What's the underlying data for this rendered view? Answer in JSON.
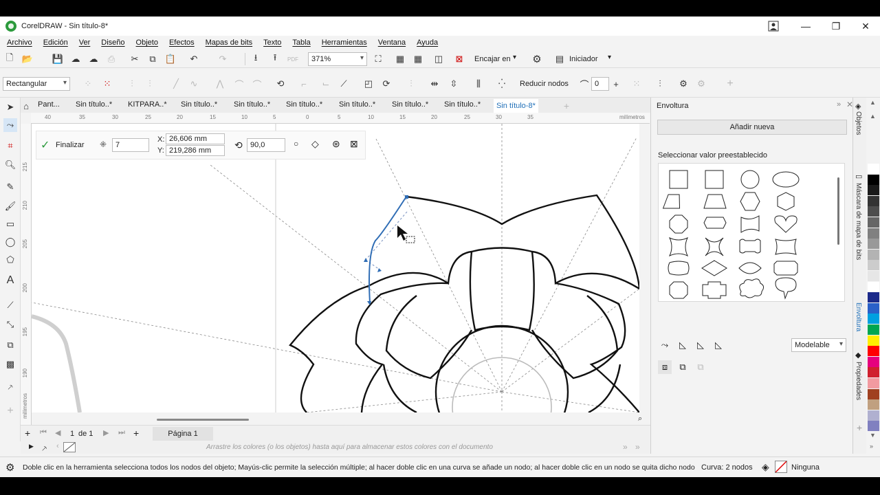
{
  "app": {
    "title": "CorelDRAW - Sin título-8*"
  },
  "menu": [
    "Archivo",
    "Edición",
    "Ver",
    "Diseño",
    "Objeto",
    "Efectos",
    "Mapas de bits",
    "Texto",
    "Tabla",
    "Herramientas",
    "Ventana",
    "Ayuda"
  ],
  "toolbar": {
    "zoom": "371%",
    "snap_label": "Encajar en",
    "launcher_label": "Iniciador"
  },
  "propertybar": {
    "selection_mode": "Rectangular",
    "reduce_nodes": "Reducir nodos",
    "curve_smoothing": "0"
  },
  "doc_tabs": [
    "Pant...",
    "Sin título..*",
    "KITPARA..*",
    "Sin título..*",
    "Sin título..*",
    "Sin título..*",
    "Sin título..*",
    "Sin título..*",
    "Sin título..*",
    "Sin título-8*"
  ],
  "active_tab_index": 9,
  "ruler": {
    "units": "milímetros",
    "h_ticks": [
      "40",
      "35",
      "30",
      "25",
      "20",
      "15",
      "10",
      "5",
      "0",
      "5",
      "10",
      "15",
      "20",
      "25",
      "30",
      "35"
    ],
    "v_ticks": [
      "215",
      "210",
      "205",
      "200",
      "195",
      "190"
    ]
  },
  "tool_props": {
    "finish_label": "Finalizar",
    "points": "7",
    "x_label": "X:",
    "x_value": "26,606 mm",
    "y_label": "Y:",
    "y_value": "219,286 mm",
    "angle": "90,0"
  },
  "page_nav": {
    "current": "1",
    "of_label": "de 1",
    "page_tab": "Página 1"
  },
  "palette_hint": "Arrastre los colores (o los objetos) hasta aquí para almacenar estos colores con el documento",
  "status": {
    "hint": "Doble clic en la herramienta selecciona todos los nodos del objeto; Mayús-clic permite la selección múltiple; al hacer doble clic en una curva se añade un nodo; al hacer doble clic en un nodo se quita dicho nodo",
    "curve_info": "Curva: 2 nodos",
    "fill_info": "Ninguna"
  },
  "docker": {
    "title": "Envoltura",
    "add_new": "Añadir nueva",
    "preset_label": "Seleccionar valor preestablecido",
    "mode": "Modelable"
  },
  "vertical_tabs": [
    "Objetos",
    "Máscara de mapa de bits",
    "Envoltura",
    "Propiedades"
  ],
  "palette_colors": [
    "#ffffff",
    "#000000",
    "#1a1a1a",
    "#333333",
    "#4d4d4d",
    "#666666",
    "#808080",
    "#999999",
    "#b3b3b3",
    "#cccccc",
    "#e6e6e6",
    "#ffffff",
    "#1b2a8a",
    "#2a60c8",
    "#00a0e0",
    "#00a651",
    "#ffee00",
    "#ff0000",
    "#e6007e",
    "#d0202e",
    "#f29aa0",
    "#a04020",
    "#c0a080",
    "#b0b0d0",
    "#8080c0"
  ]
}
